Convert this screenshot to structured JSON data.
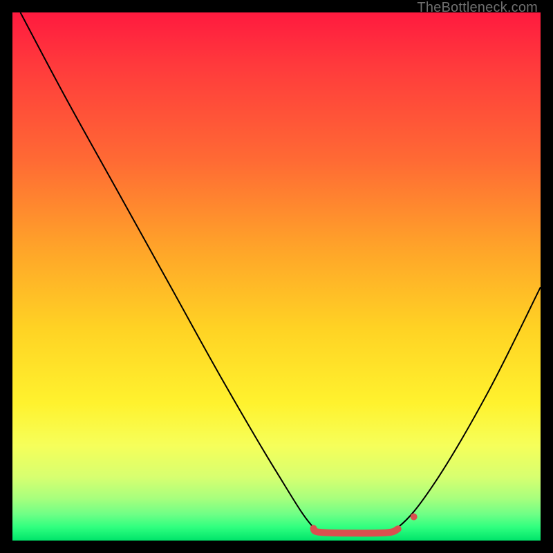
{
  "watermark": {
    "text": "TheBottleneck.com"
  },
  "chart_data": {
    "type": "line",
    "title": "",
    "xlabel": "",
    "ylabel": "",
    "xlim": [
      0,
      100
    ],
    "ylim": [
      0,
      100
    ],
    "grid": false,
    "legend": false,
    "background_gradient": {
      "stops": [
        {
          "pos": 0.0,
          "color": "#ff1a3f"
        },
        {
          "pos": 0.45,
          "color": "#ffa529"
        },
        {
          "pos": 0.74,
          "color": "#fff22e"
        },
        {
          "pos": 0.92,
          "color": "#a8ff7d"
        },
        {
          "pos": 1.0,
          "color": "#00e46a"
        }
      ]
    },
    "series": [
      {
        "name": "bottleneck-curve",
        "color": "#000000",
        "width": 2,
        "points": [
          {
            "x": 1.5,
            "y": 100.0
          },
          {
            "x": 10.0,
            "y": 84.0
          },
          {
            "x": 20.0,
            "y": 66.0
          },
          {
            "x": 30.0,
            "y": 48.0
          },
          {
            "x": 40.0,
            "y": 30.0
          },
          {
            "x": 50.0,
            "y": 13.0
          },
          {
            "x": 57.0,
            "y": 2.5
          },
          {
            "x": 61.0,
            "y": 1.5
          },
          {
            "x": 68.0,
            "y": 1.5
          },
          {
            "x": 73.0,
            "y": 2.5
          },
          {
            "x": 80.0,
            "y": 11.0
          },
          {
            "x": 90.0,
            "y": 28.0
          },
          {
            "x": 100.0,
            "y": 48.0
          }
        ]
      },
      {
        "name": "optimal-range-marker",
        "color": "#d9504f",
        "width": 10,
        "cap": "round",
        "points": [
          {
            "x": 57.0,
            "y": 2.3
          },
          {
            "x": 58.0,
            "y": 1.6
          },
          {
            "x": 64.0,
            "y": 1.4
          },
          {
            "x": 71.0,
            "y": 1.5
          },
          {
            "x": 73.0,
            "y": 2.2
          }
        ]
      },
      {
        "name": "marker-dot",
        "type": "scatter",
        "color": "#d9504f",
        "radius": 5,
        "points": [
          {
            "x": 76.0,
            "y": 4.5
          }
        ]
      }
    ]
  }
}
